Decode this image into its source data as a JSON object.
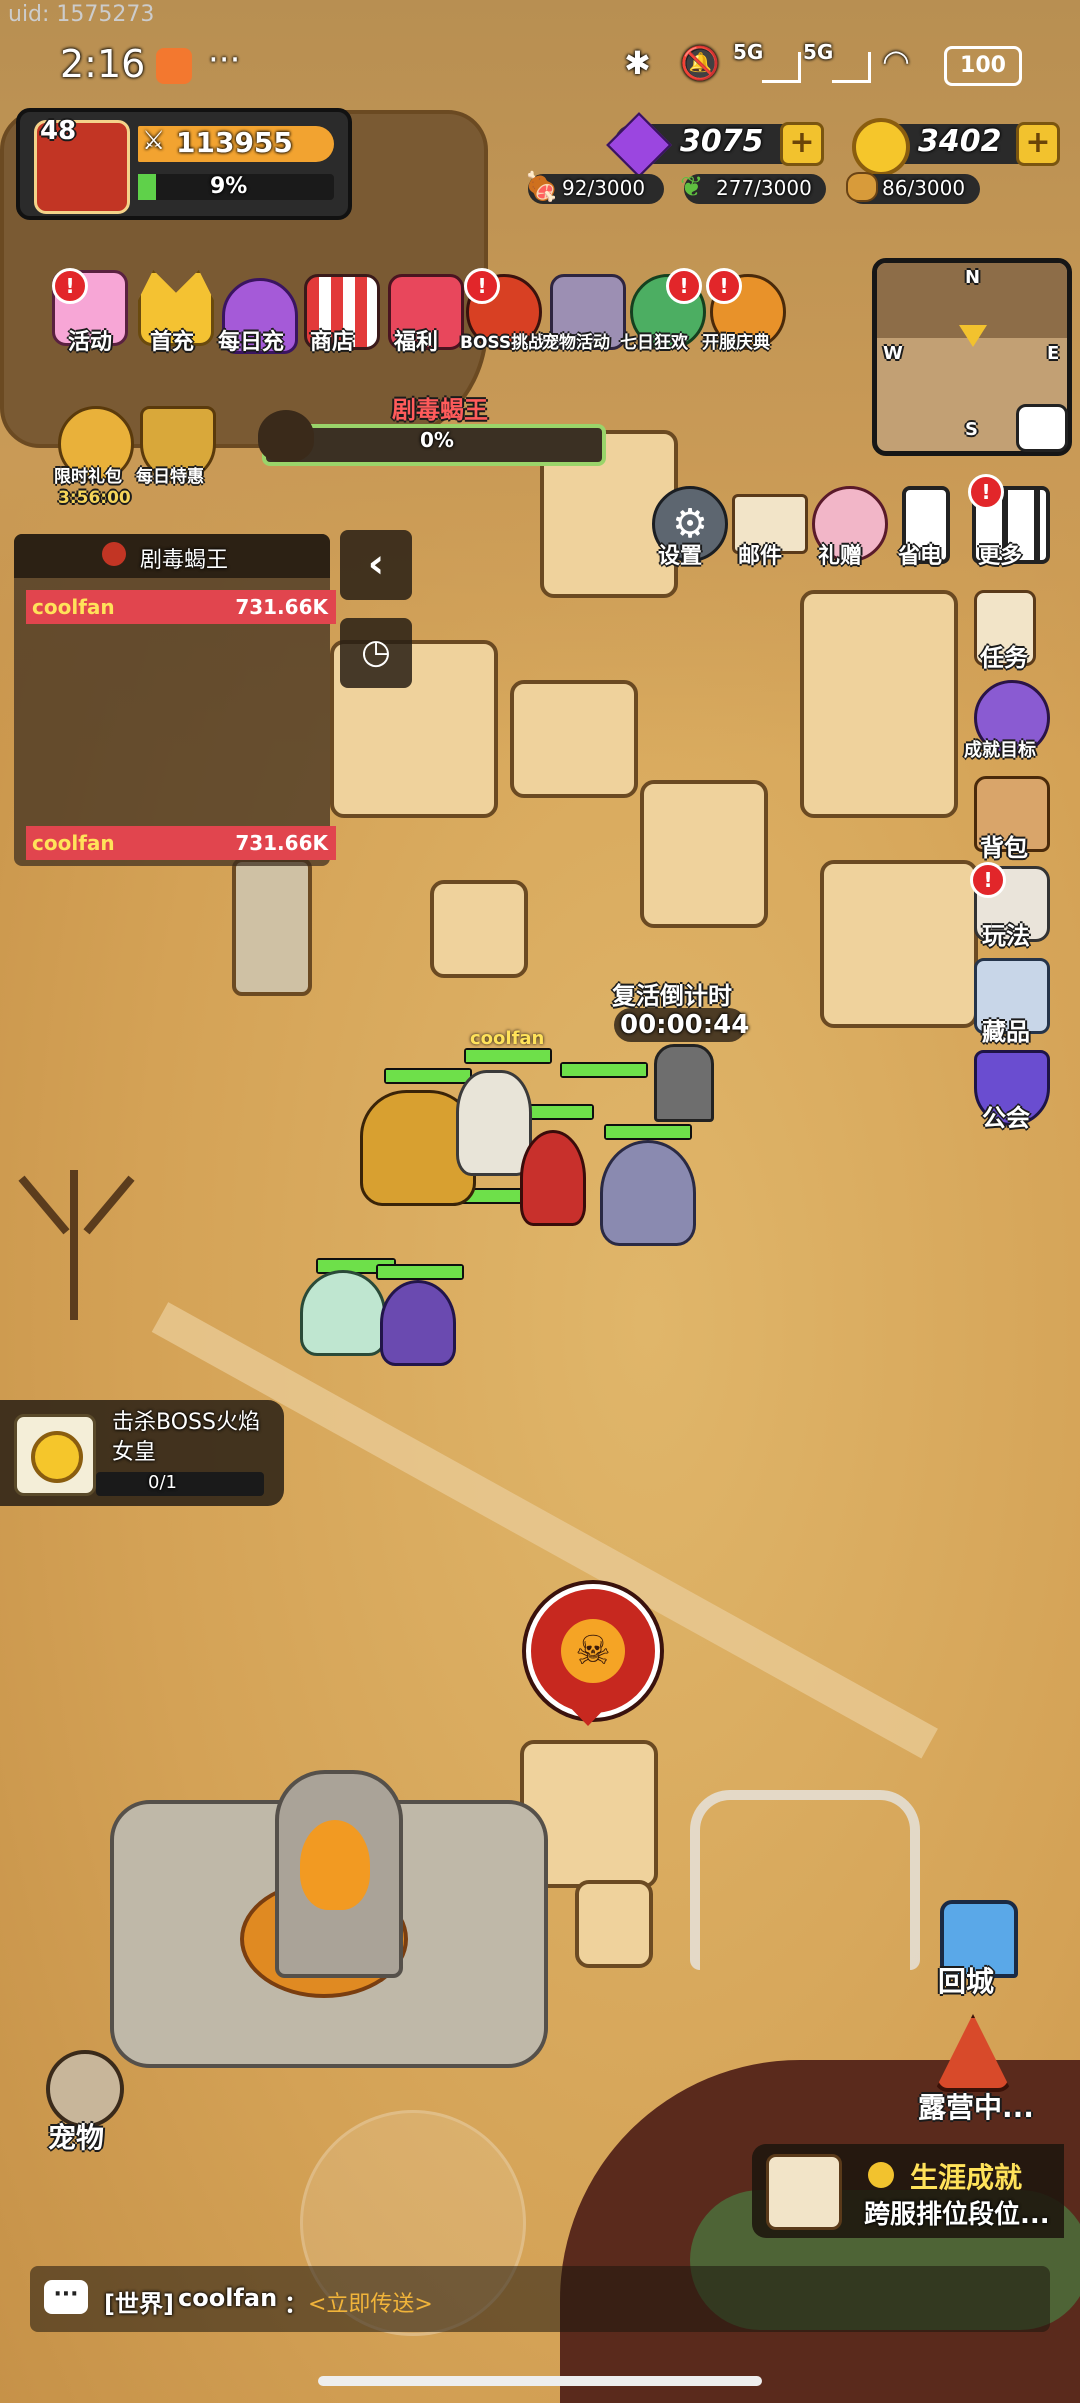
{
  "uid": "uid: 1575273",
  "status_bar": {
    "time": "2:16",
    "dots": "···",
    "net1": "5G",
    "net2": "5G",
    "battery": "100"
  },
  "player": {
    "level": "48",
    "power": "113955",
    "exp_percent": "9%"
  },
  "currencies": {
    "gems": "3075",
    "gold": "3402",
    "meat": "92/3000",
    "leaf": "277/3000",
    "ore": "86/3000",
    "plus": "+"
  },
  "top_menu": [
    {
      "label": "活动",
      "icon": "event-icon",
      "badge": "!"
    },
    {
      "label": "首充",
      "icon": "crown-icon",
      "badge": ""
    },
    {
      "label": "每日充",
      "icon": "gem-pile-icon",
      "badge": ""
    },
    {
      "label": "商店",
      "icon": "shop-icon",
      "badge": ""
    },
    {
      "label": "福利",
      "icon": "gift-icon",
      "badge": ""
    },
    {
      "label": "BOSS挑战",
      "icon": "boss-icon",
      "badge": "!"
    },
    {
      "label": "宠物活动",
      "icon": "pet-chest-icon",
      "badge": ""
    },
    {
      "label": "七日狂欢",
      "icon": "seven-day-icon",
      "badge": "!"
    },
    {
      "label": "开服庆典",
      "icon": "celebration-icon",
      "badge": "!"
    }
  ],
  "second_row": [
    {
      "label": "限时礼包",
      "icon": "timer-gift-icon",
      "timer": "3:56:00"
    },
    {
      "label": "每日特惠",
      "icon": "scale-icon"
    }
  ],
  "boss_bar": {
    "name": "剧毒蝎王",
    "percent": "0%",
    "progress": 0
  },
  "minimap": {
    "n": "N",
    "e": "E",
    "s": "S",
    "w": "W"
  },
  "utility_row": [
    {
      "label": "设置",
      "icon": "gear-icon"
    },
    {
      "label": "邮件",
      "icon": "mail-icon"
    },
    {
      "label": "礼赠",
      "icon": "gift-bouquet-icon"
    },
    {
      "label": "省电",
      "icon": "battery-icon"
    },
    {
      "label": "更多",
      "icon": "grid-icon",
      "badge": "!"
    }
  ],
  "damage_panel": {
    "title": "剧毒蝎王",
    "rows": [
      {
        "name": "coolfan",
        "value": "731.66K"
      }
    ],
    "self_row": {
      "name": "coolfan",
      "value": "731.66K"
    }
  },
  "right_menu": [
    {
      "label": "任务",
      "icon": "scroll-icon",
      "badge": ""
    },
    {
      "label": "成就目标",
      "icon": "trophy-icon",
      "badge": ""
    },
    {
      "label": "背包",
      "icon": "backpack-icon",
      "badge": ""
    },
    {
      "label": "玩法",
      "icon": "sword-icon",
      "badge": "!"
    },
    {
      "label": "藏品",
      "icon": "star-trophy-icon",
      "badge": ""
    },
    {
      "label": "公会",
      "icon": "shield-icon",
      "badge": ""
    }
  ],
  "revive": {
    "label": "复活倒计时",
    "countdown": "00:00:44"
  },
  "party": {
    "leader_name": "coolfan"
  },
  "quest": {
    "text": "击杀BOSS火焰女皇",
    "progress": "0/1"
  },
  "bottom_buttons": {
    "return_city": "回城",
    "camping": "露营中...",
    "pet": "宠物"
  },
  "career": {
    "title": "生涯成就",
    "subtitle": "跨服排位段位..."
  },
  "chat": {
    "channel": "[世界]",
    "name": "coolfan",
    "sep": "：",
    "link": "<立即传送>"
  }
}
